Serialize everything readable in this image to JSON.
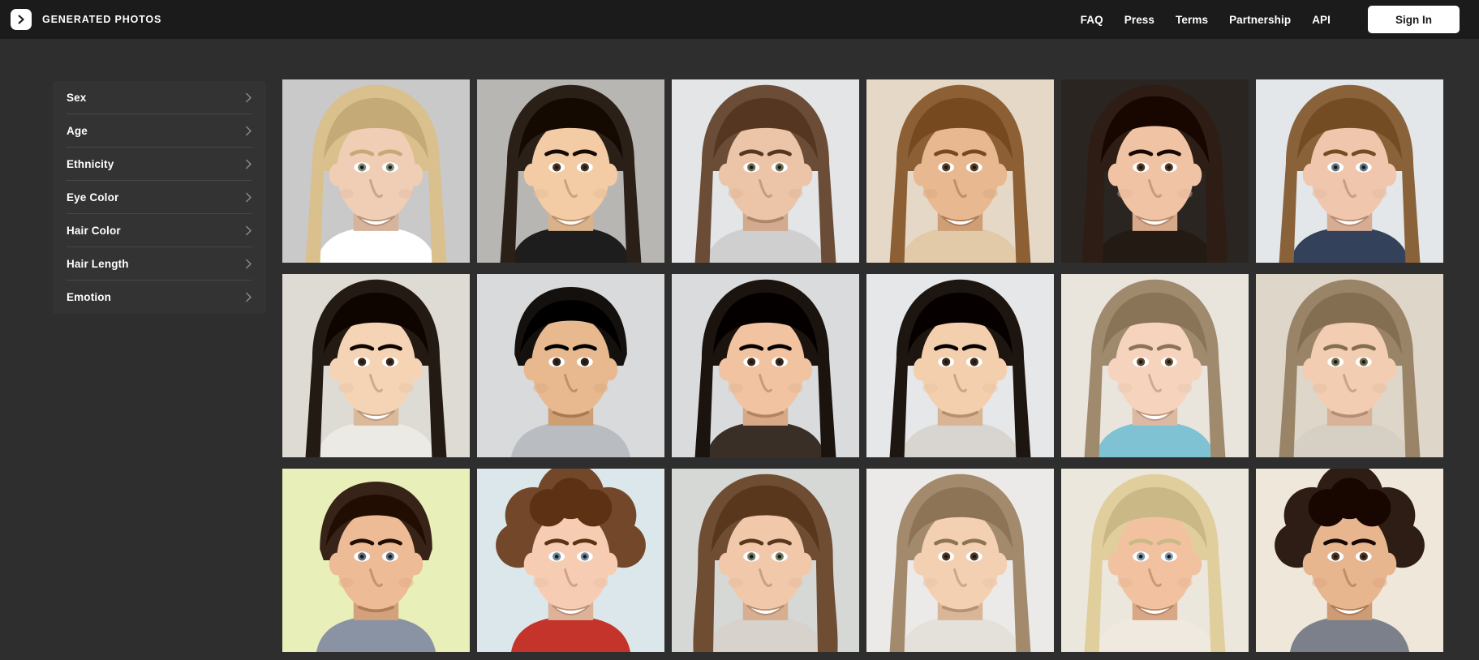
{
  "header": {
    "logo_icon": "chevron-right-logo-icon",
    "brand_name": "GENERATED PHOTOS",
    "nav_links": [
      {
        "label": "FAQ"
      },
      {
        "label": "Press"
      },
      {
        "label": "Terms"
      },
      {
        "label": "Partnership"
      },
      {
        "label": "API"
      }
    ],
    "sign_in_label": "Sign In"
  },
  "sidebar": {
    "filters": [
      {
        "label": "Sex",
        "chevron": "chevron-right-icon"
      },
      {
        "label": "Age",
        "chevron": "chevron-right-icon"
      },
      {
        "label": "Ethnicity",
        "chevron": "chevron-right-icon"
      },
      {
        "label": "Eye Color",
        "chevron": "chevron-right-icon"
      },
      {
        "label": "Hair Color",
        "chevron": "chevron-right-icon"
      },
      {
        "label": "Hair Length",
        "chevron": "chevron-right-icon"
      },
      {
        "label": "Emotion",
        "chevron": "chevron-right-icon"
      }
    ]
  },
  "gallery": {
    "columns": 6,
    "rows": 3,
    "photos": [
      {
        "bg": "#c9c9c9",
        "skin": "#f0cdb5",
        "hair": "#d9c08c",
        "hair_style": "long",
        "eye": "#7d8f7a",
        "top": "#ffffff",
        "smile": true
      },
      {
        "bg": "#b8b6b2",
        "skin": "#f3cba4",
        "hair": "#2b2018",
        "hair_style": "long",
        "eye": "#4a3526",
        "top": "#1d1d1d",
        "smile": true
      },
      {
        "bg": "#e3e5e6",
        "skin": "#ecc4a8",
        "hair": "#6b4c36",
        "hair_style": "long",
        "eye": "#6a6f55",
        "top": "#cfcfcf",
        "smile": false
      },
      {
        "bg": "#e6d8c6",
        "skin": "#e8b890",
        "hair": "#8d5f35",
        "hair_style": "long",
        "eye": "#5a4128",
        "top": "#e2c9a8",
        "smile": true
      },
      {
        "bg": "#2a2520",
        "skin": "#f0c3a4",
        "hair": "#2e1d14",
        "hair_style": "wavy",
        "eye": "#4e3a27",
        "top": "#241a14",
        "smile": true
      },
      {
        "bg": "#e4e7ea",
        "skin": "#f0c6ad",
        "hair": "#8a6239",
        "hair_style": "long",
        "eye": "#5d7b8c",
        "top": "#33415a",
        "smile": true
      },
      {
        "bg": "#dedbd4",
        "skin": "#f4d4b5",
        "hair": "#241a14",
        "hair_style": "long",
        "eye": "#3b2a1d",
        "top": "#eceae4",
        "smile": true
      },
      {
        "bg": "#d9dadc",
        "skin": "#e8b98e",
        "hair": "#14100d",
        "hair_style": "short",
        "eye": "#2f2219",
        "top": "#b9bcc1",
        "smile": false
      },
      {
        "bg": "#dadbdd",
        "skin": "#f1c3a1",
        "hair": "#1b130e",
        "hair_style": "long",
        "eye": "#3a291c",
        "top": "#3a2f27",
        "smile": false
      },
      {
        "bg": "#e6e7e9",
        "skin": "#f4cfae",
        "hair": "#1d1510",
        "hair_style": "long",
        "eye": "#3a281b",
        "top": "#d8d5d0",
        "smile": false
      },
      {
        "bg": "#e9e4dc",
        "skin": "#f6d3bc",
        "hair": "#a08a6e",
        "hair_style": "long",
        "eye": "#5b4a33",
        "top": "#7fc2d4",
        "smile": true
      },
      {
        "bg": "#ded6c9",
        "skin": "#f2cdb1",
        "hair": "#9a8468",
        "hair_style": "long",
        "eye": "#6d6a50",
        "top": "#d6cfc3",
        "smile": false
      },
      {
        "bg": "#e8efb9",
        "skin": "#edbb95",
        "hair": "#372318",
        "hair_style": "short",
        "eye": "#5e7182",
        "top": "#8a93a3",
        "smile": false
      },
      {
        "bg": "#dbe7ea",
        "skin": "#f6cdb2",
        "hair": "#73472a",
        "hair_style": "curly",
        "eye": "#6e8ba0",
        "top": "#c5342a",
        "smile": true
      },
      {
        "bg": "#d6d8d6",
        "skin": "#f2c8ab",
        "hair": "#6f4d33",
        "hair_style": "wavy",
        "eye": "#6c7b63",
        "top": "#d7d2cb",
        "smile": true
      },
      {
        "bg": "#eceae8",
        "skin": "#f4d0b2",
        "hair": "#a38a6c",
        "hair_style": "long",
        "eye": "#4e3a28",
        "top": "#e4e0da",
        "smile": false
      },
      {
        "bg": "#ece7dd",
        "skin": "#f2c2a0",
        "hair": "#e0cf9c",
        "hair_style": "long",
        "eye": "#7b9ab0",
        "top": "#efe9df",
        "smile": true
      },
      {
        "bg": "#efe7da",
        "skin": "#e7b58e",
        "hair": "#2d1d14",
        "hair_style": "curly",
        "eye": "#4e3726",
        "top": "#7b808a",
        "smile": true
      }
    ]
  },
  "colors": {
    "header_bg": "#1b1b1b",
    "page_bg": "#2e2e2e",
    "card_bg": "#333333",
    "divider": "#474747",
    "text": "#ffffff",
    "accent": "#ffffff"
  }
}
